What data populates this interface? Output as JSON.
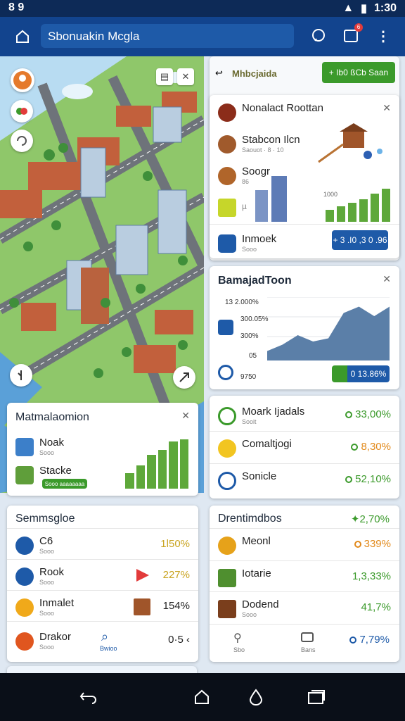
{
  "status": {
    "left": "8 9",
    "time": "1:30"
  },
  "appbar": {
    "search": "Sbonuakin Mcgla",
    "notif_badge": "6"
  },
  "colors": {
    "appbar": "#12448e",
    "accent_green": "#3b9a2b",
    "accent_blue": "#1e5aa8",
    "accent_orange": "#e28a1c"
  },
  "top_card": {
    "tab": "Mhbcjaida",
    "action": "+ Ib0 ßCb Saan",
    "rows": [
      {
        "name": "Nonalact Roottan",
        "sub": "",
        "icon": "leaf-icon"
      },
      {
        "name": "Stabcon Ilcn",
        "sub": "Saouot · 8 · 10",
        "icon": "bread-icon"
      },
      {
        "name": "Soogr",
        "sub": "86",
        "icon": "bowl-icon"
      },
      {
        "name": "",
        "sub": "µ",
        "icon": "box-icon"
      }
    ],
    "bar_label": "1000",
    "bars": [
      0.35,
      0.45,
      0.55,
      0.65,
      0.8,
      0.95
    ],
    "bottom_row": {
      "name": "Inmoek",
      "sub": "Sooo",
      "button": "+ 3 .I0 ,3 0 .96"
    }
  },
  "chart_card": {
    "title": "BamajadToon",
    "y_ticks": [
      "13 2.000%",
      "300.05%",
      "300%",
      "05"
    ],
    "icons_lbl": "9750",
    "line": [
      0.15,
      0.25,
      0.4,
      0.3,
      0.35,
      0.75,
      0.85,
      0.7,
      0.85
    ],
    "pill": "0 13.86%"
  },
  "mid_card": {
    "rows": [
      {
        "name": "Moark Ijadals",
        "sub": "Sooit",
        "value": "33,00%",
        "color": "green",
        "icon": "book-icon"
      },
      {
        "name": "Comaltjogi",
        "sub": "",
        "value": "8,30%",
        "color": "orange",
        "icon": "star-icon"
      },
      {
        "name": "Sonicle",
        "sub": "",
        "value": "52,10%",
        "color": "green",
        "icon": "arch-icon"
      }
    ]
  },
  "left_card": {
    "title": "Matmalaomion",
    "rows": [
      {
        "name": "Noak",
        "sub": "Sooo",
        "icon": "pin-icon"
      },
      {
        "name": "Stacke",
        "sub": "",
        "icon": "map-icon"
      }
    ],
    "pill": "Sooo aaaaaaaa",
    "bars": [
      0.3,
      0.45,
      0.65,
      0.75,
      0.9,
      0.95
    ]
  },
  "bottom_left": {
    "title": "Semmsgloe",
    "rows": [
      {
        "name": "C6",
        "sub": "Sooo",
        "value": "1l50%",
        "color": "orange",
        "icon": "compass-icon"
      },
      {
        "name": "Rook",
        "sub": "Sooo",
        "value": "227%",
        "color": "orange",
        "icon": "clock-icon"
      },
      {
        "name": "Inmalet",
        "sub": "Sooo",
        "value": "154%",
        "color": "dark",
        "icon": "coin-icon"
      },
      {
        "name": "Drakor",
        "sub": "Sooo",
        "value": "0·5",
        "color": "dark",
        "icon": "flame-icon",
        "extra": "Bwioo"
      }
    ]
  },
  "bottom_right": {
    "title": "Drentimdbos",
    "title_value": "2,70%",
    "rows": [
      {
        "name": "Meonl",
        "sub": "",
        "value": "339%",
        "color": "orange",
        "icon": "coins-icon"
      },
      {
        "name": "Iotarie",
        "sub": "",
        "value": "1,3,33%",
        "color": "green",
        "icon": "plant-icon"
      },
      {
        "name": "Dodend",
        "sub": "Sooo",
        "value": "41,7%",
        "color": "green",
        "icon": "chest-icon"
      }
    ],
    "footer": {
      "left": "Sbo",
      "mid": "Bans",
      "value": "7,79%"
    }
  }
}
